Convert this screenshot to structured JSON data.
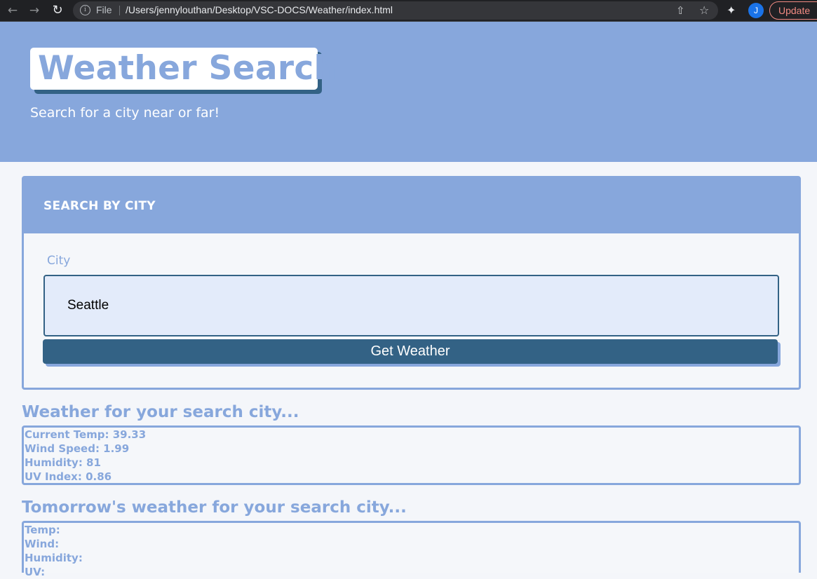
{
  "browser": {
    "scheme_label": "File",
    "url": "/Users/jennylouthan/Desktop/VSC-DOCS/Weather/index.html",
    "profile_initial": "J",
    "update_label": "Update",
    "icons": [
      "back-arrow-icon",
      "forward-arrow-icon",
      "reload-icon",
      "info-icon",
      "share-icon",
      "bookmark-star-icon",
      "extensions-puzzle-icon"
    ]
  },
  "colors": {
    "accent": "#87a7dc",
    "dark": "#336285",
    "input_bg": "#e3ebfa",
    "page_bg": "#f4f6fa"
  },
  "header": {
    "title": "Weather Search",
    "subtitle": "Search for a city near or far!"
  },
  "search": {
    "card_title": "SEARCH BY CITY",
    "city_label": "City",
    "city_value": "Seattle",
    "button_label": "Get Weather"
  },
  "current": {
    "heading": "Weather for your search city...",
    "lines": [
      "Current Temp: 39.33",
      "Wind Speed: 1.99",
      "Humidity: 81",
      "UV Index: 0.86"
    ]
  },
  "tomorrow": {
    "heading": "Tomorrow's weather for your search city...",
    "lines": [
      "Temp:",
      "Wind:",
      "Humidity:",
      "UV:"
    ]
  }
}
